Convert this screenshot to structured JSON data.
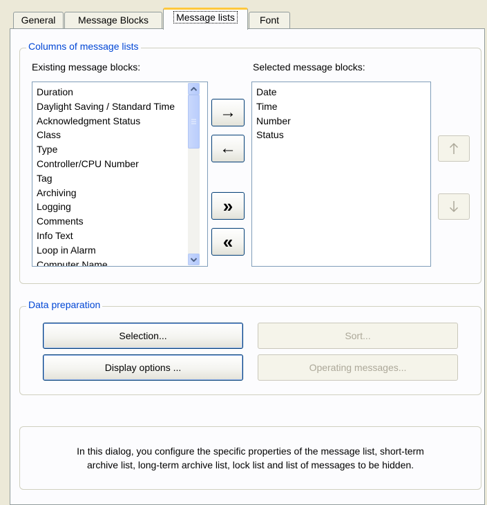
{
  "tabs": [
    {
      "label": "General"
    },
    {
      "label": "Message Blocks"
    },
    {
      "label": "Message lists"
    },
    {
      "label": "Font"
    }
  ],
  "columns_group": {
    "title": "Columns of message lists",
    "existing_label": "Existing message blocks:",
    "selected_label": "Selected message blocks:",
    "existing_items": [
      "Duration",
      "Daylight Saving / Standard Time",
      "Acknowledgment Status",
      "Class",
      "Type",
      "Controller/CPU Number",
      "Tag",
      "Archiving",
      "Logging",
      "Comments",
      "Info Text",
      "Loop in Alarm",
      "Computer Name"
    ],
    "selected_items": [
      "Date",
      "Time",
      "Number",
      "Status"
    ],
    "buttons": {
      "add": "→",
      "remove": "←",
      "add_all": "»",
      "remove_all": "«"
    }
  },
  "data_preparation": {
    "title": "Data preparation",
    "selection": "Selection...",
    "sort": "Sort...",
    "display_options": "Display options ...",
    "operating_messages": "Operating messages..."
  },
  "info": {
    "line1": "In this dialog, you configure the specific properties of the message list, short-term",
    "line2": "archive list, long-term archive list, lock list and list of messages to be hidden."
  },
  "icons": {
    "move_up": "up-arrow-icon",
    "move_down": "down-arrow-icon",
    "scroll_up": "chevron-up-icon",
    "scroll_down": "chevron-down-icon"
  },
  "colors": {
    "accent_tab": "#ffc83c",
    "group_title": "#0046d5",
    "button_border": "#003c74"
  }
}
